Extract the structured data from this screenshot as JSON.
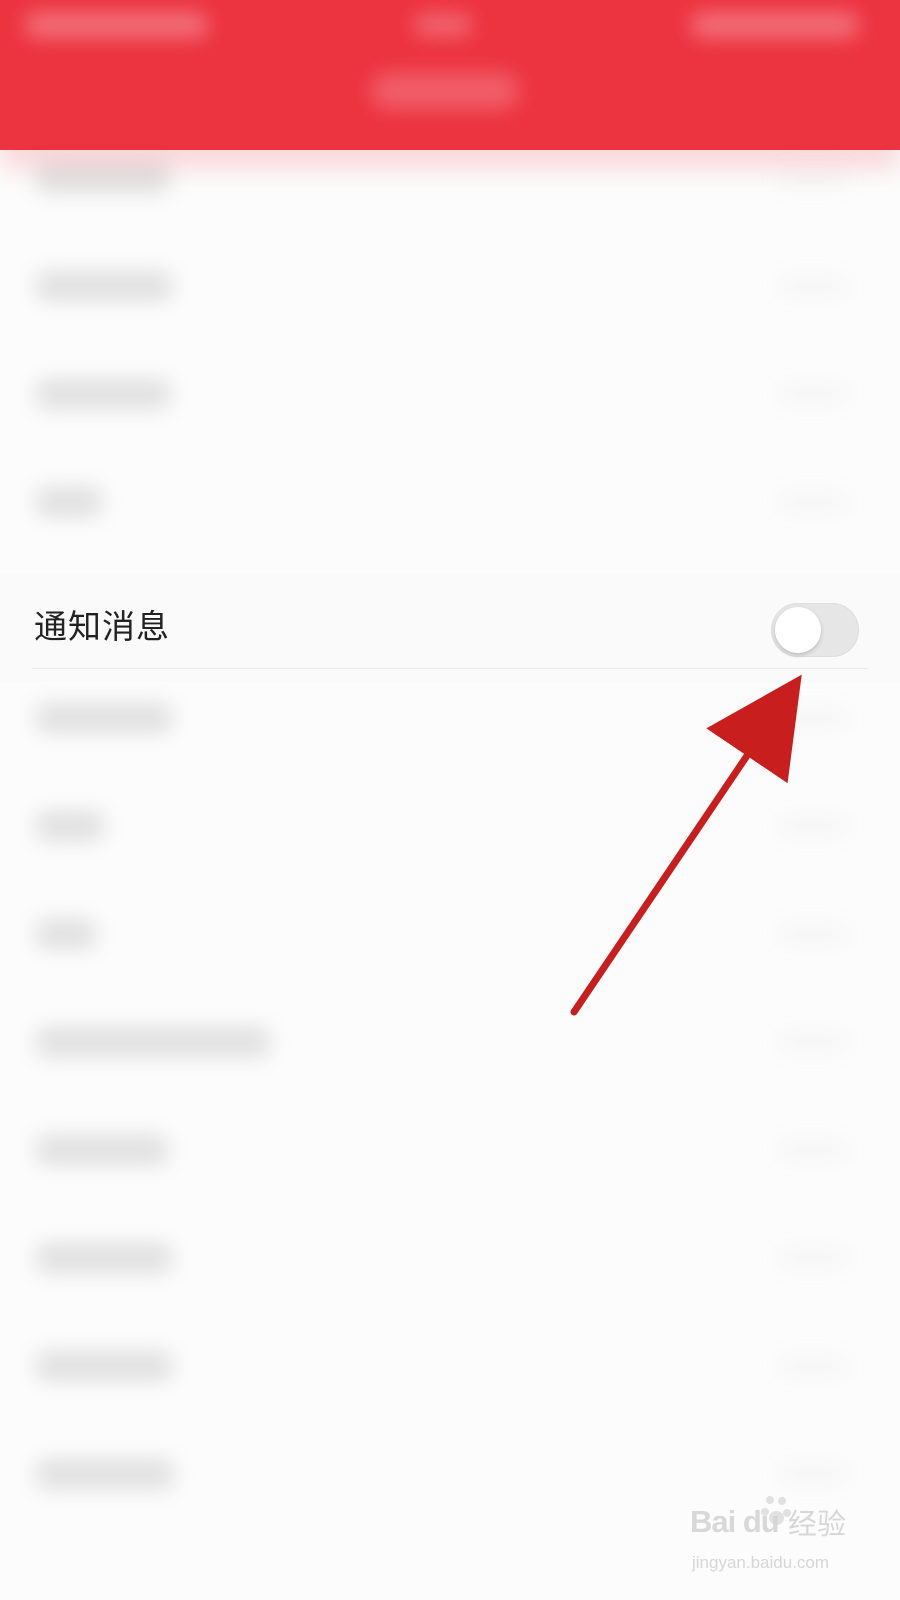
{
  "screen": {
    "topbar": {
      "background_color": "#ec3340"
    },
    "settings": {
      "visible_item": {
        "label": "通知消息",
        "toggle_state": "off"
      }
    },
    "annotation": {
      "arrow_color": "#c81e1e"
    },
    "watermark": {
      "brand": "Bai du",
      "brand_cn": "经验",
      "url": "jingyan.baidu.com"
    }
  }
}
